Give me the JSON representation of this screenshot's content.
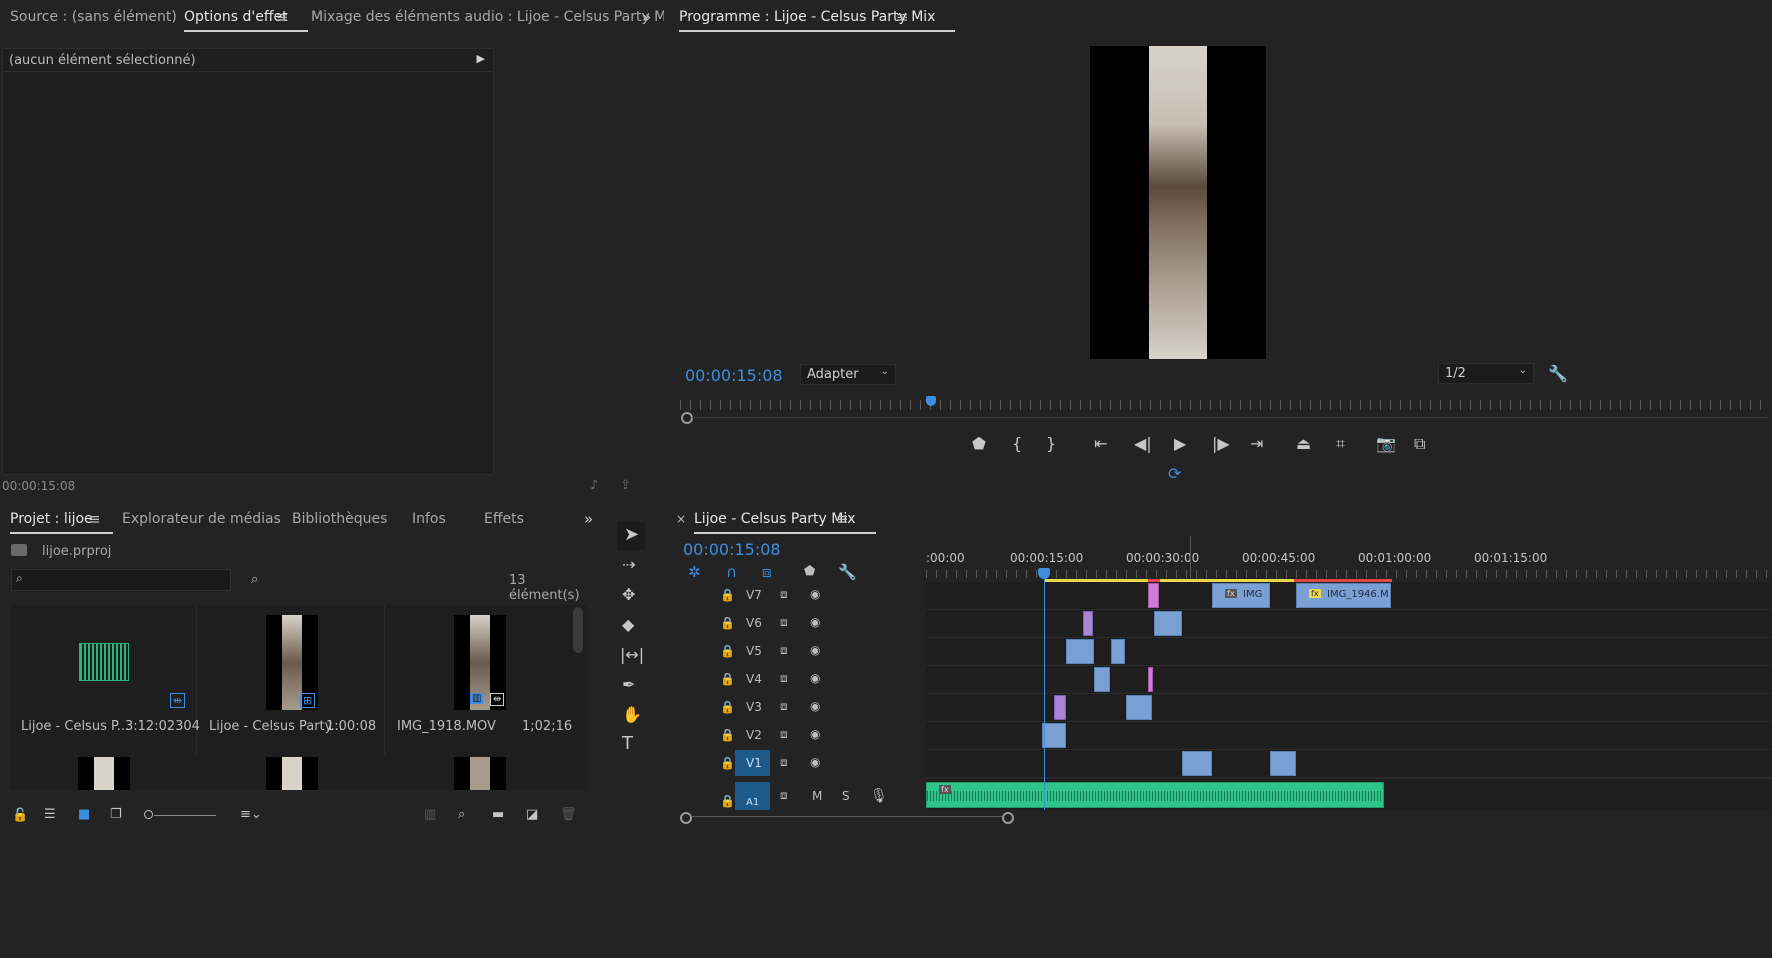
{
  "source_panel": {
    "tabs": [
      "Source : (sans élément)",
      "Options d'effet",
      "Mixage des éléments audio : Lijoe - Celsus Party Mix"
    ],
    "no_selection": "(aucun élément sélectionné)",
    "timecode": "00:00:15:08"
  },
  "program_monitor": {
    "title": "Programme : Lijoe - Celsus Party Mix",
    "timecode": "00:00:15:08",
    "fit": "Adapter",
    "resolution": "1/2"
  },
  "project_panel": {
    "tabs": [
      "Projet : lijoe",
      "Explorateur de médias",
      "Bibliothèques",
      "Infos",
      "Effets"
    ],
    "project_file": "lijoe.prproj",
    "item_count": "13 élément(s)",
    "search_placeholder": "",
    "items": [
      {
        "name": "Lijoe - Celsus P...",
        "duration": "3:12:02304"
      },
      {
        "name": "Lijoe - Celsus Party...",
        "duration": "1:00:08"
      },
      {
        "name": "IMG_1918.MOV",
        "duration": "1;02;16"
      }
    ]
  },
  "timeline": {
    "sequence_name": "Lijoe - Celsus Party Mix",
    "timecode": "00:00:15:08",
    "ruler_labels": [
      ":00:00",
      "00:00:15:00",
      "00:00:30:00",
      "00:00:45:00",
      "00:01:00:00",
      "00:01:15:00"
    ],
    "tracks": [
      "V7",
      "V6",
      "V5",
      "V4",
      "V3",
      "V2",
      "V1",
      "A1"
    ],
    "clip_labels": [
      "IMG",
      "IMG_1946.M"
    ],
    "audio_m": "M",
    "audio_s": "S"
  },
  "colors": {
    "accent": "#3e8ee0",
    "clip_video": "#7ba1d4",
    "clip_pink": "#d27bd4",
    "audio": "#2fc48a"
  }
}
